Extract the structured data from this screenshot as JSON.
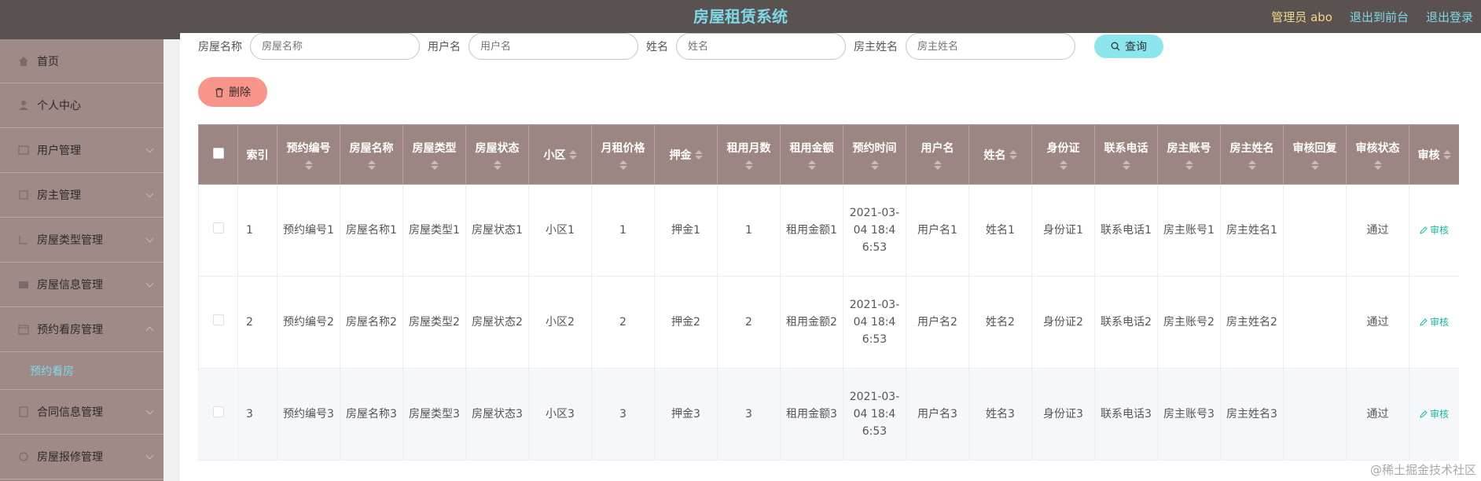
{
  "header": {
    "title": "房屋租赁系统",
    "admin_label": "管理员 abo",
    "to_front": "退出到前台",
    "logout": "退出登录"
  },
  "sidebar": {
    "items": [
      {
        "label": "首页",
        "icon": "home-icon"
      },
      {
        "label": "个人中心",
        "icon": "user-icon"
      },
      {
        "label": "用户管理",
        "icon": "users-icon"
      },
      {
        "label": "房主管理",
        "icon": "landlord-icon"
      },
      {
        "label": "房屋类型管理",
        "icon": "category-icon"
      },
      {
        "label": "房屋信息管理",
        "icon": "house-icon"
      },
      {
        "label": "预约看房管理",
        "icon": "calendar-icon"
      },
      {
        "label": "合同信息管理",
        "icon": "contract-icon"
      },
      {
        "label": "房屋报修管理",
        "icon": "repair-icon"
      }
    ],
    "sub_active": "预约看房"
  },
  "search": {
    "house_name_label": "房屋名称",
    "house_name_placeholder": "房屋名称",
    "username_label": "用户名",
    "username_placeholder": "用户名",
    "name_label": "姓名",
    "name_placeholder": "姓名",
    "landlord_label": "房主姓名",
    "landlord_placeholder": "房主姓名",
    "query_button": "查询"
  },
  "toolbar": {
    "delete_button": "删除"
  },
  "table": {
    "columns": [
      "索引",
      "预约编号",
      "房屋名称",
      "房屋类型",
      "房屋状态",
      "小区",
      "月租价格",
      "押金",
      "租用月数",
      "租用金额",
      "预约时间",
      "用户名",
      "姓名",
      "身份证",
      "联系电话",
      "房主账号",
      "房主姓名",
      "审核回复",
      "审核状态",
      "审核"
    ],
    "rows": [
      {
        "index": "1",
        "booking_no": "预约编号1",
        "house_name": "房屋名称1",
        "house_type": "房屋类型1",
        "house_status": "房屋状态1",
        "community": "小区1",
        "monthly_rent": "1",
        "deposit": "押金1",
        "months": "1",
        "amount": "租用金额1",
        "time": "2021-03-04 18:46:53",
        "username": "用户名1",
        "name": "姓名1",
        "id_card": "身份证1",
        "phone": "联系电话1",
        "landlord_account": "房主账号1",
        "landlord_name": "房主姓名1",
        "reply": "",
        "status": "通过",
        "action": "审核"
      },
      {
        "index": "2",
        "booking_no": "预约编号2",
        "house_name": "房屋名称2",
        "house_type": "房屋类型2",
        "house_status": "房屋状态2",
        "community": "小区2",
        "monthly_rent": "2",
        "deposit": "押金2",
        "months": "2",
        "amount": "租用金额2",
        "time": "2021-03-04 18:46:53",
        "username": "用户名2",
        "name": "姓名2",
        "id_card": "身份证2",
        "phone": "联系电话2",
        "landlord_account": "房主账号2",
        "landlord_name": "房主姓名2",
        "reply": "",
        "status": "通过",
        "action": "审核"
      },
      {
        "index": "3",
        "booking_no": "预约编号3",
        "house_name": "房屋名称3",
        "house_type": "房屋类型3",
        "house_status": "房屋状态3",
        "community": "小区3",
        "monthly_rent": "3",
        "deposit": "押金3",
        "months": "3",
        "amount": "租用金额3",
        "time": "2021-03-04 18:46:53",
        "username": "用户名3",
        "name": "姓名3",
        "id_card": "身份证3",
        "phone": "联系电话3",
        "landlord_account": "房主账号3",
        "landlord_name": "房主姓名3",
        "reply": "",
        "status": "通过",
        "action": "审核"
      }
    ]
  },
  "watermark": "@稀土掘金技术社区",
  "colors": {
    "header_bg": "#5a5251",
    "title_color": "#7fd8e8",
    "admin_color": "#f2d98a",
    "sidebar_bg": "#a08a87",
    "table_head_bg": "#9c8582",
    "delete_bg": "#f7958b",
    "query_bg": "#8ce6ee",
    "audit_link": "#19b7a0"
  }
}
